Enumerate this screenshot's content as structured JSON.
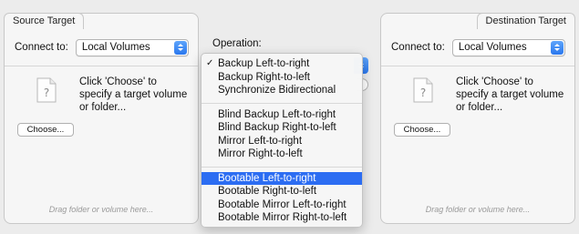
{
  "source_panel": {
    "title": "Source Target",
    "connect_label": "Connect to:",
    "connect_value": "Local Volumes",
    "hint": "Click 'Choose' to specify a target volume or folder...",
    "choose_label": "Choose...",
    "drag_hint": "Drag folder or volume here..."
  },
  "destination_panel": {
    "title": "Destination Target",
    "connect_label": "Connect to:",
    "connect_value": "Local Volumes",
    "hint": "Click 'Choose' to specify a target volume or folder...",
    "choose_label": "Choose...",
    "drag_hint": "Drag folder or volume here..."
  },
  "operation": {
    "label": "Operation:",
    "menu_groups": [
      [
        {
          "label": "Backup Left-to-right",
          "checked": true
        },
        {
          "label": "Backup Right-to-left"
        },
        {
          "label": "Synchronize Bidirectional"
        }
      ],
      [
        {
          "label": "Blind Backup Left-to-right"
        },
        {
          "label": "Blind Backup Right-to-left"
        },
        {
          "label": "Mirror Left-to-right"
        },
        {
          "label": "Mirror Right-to-left"
        }
      ],
      [
        {
          "label": "Bootable Left-to-right",
          "highlighted": true
        },
        {
          "label": "Bootable Right-to-left"
        },
        {
          "label": "Bootable Mirror Left-to-right"
        },
        {
          "label": "Bootable Mirror Right-to-left"
        }
      ]
    ],
    "check_glyph": "✓"
  },
  "colors": {
    "accent": "#2c6df2",
    "popup_button": "#3c86f5"
  }
}
